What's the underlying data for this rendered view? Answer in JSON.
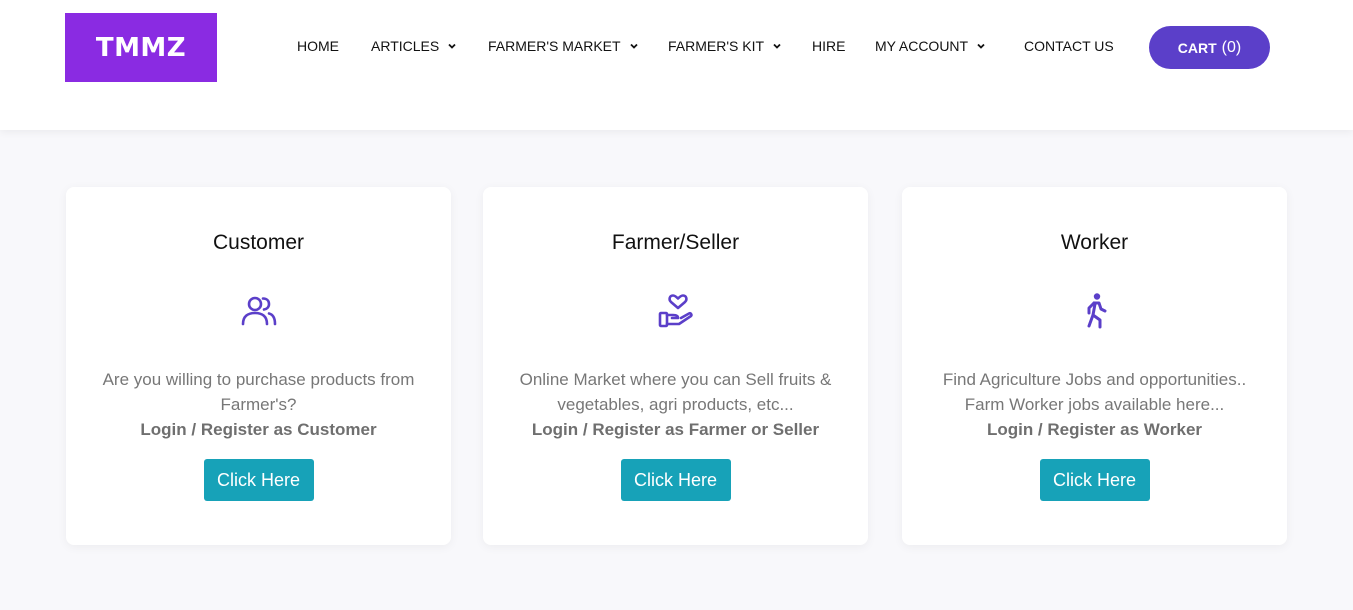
{
  "brand": {
    "logo_text": "TMMZ"
  },
  "nav": {
    "items": [
      {
        "label": "HOME"
      },
      {
        "label": "ARTICLES"
      },
      {
        "label": "FARMER'S MARKET"
      },
      {
        "label": "FARMER'S KIT"
      },
      {
        "label": "HIRE"
      },
      {
        "label": "MY ACCOUNT"
      },
      {
        "label": "CONTACT US"
      }
    ],
    "cart_label": "CART",
    "cart_count": "(0)"
  },
  "cards": [
    {
      "title": "Customer",
      "icon": "users-icon",
      "description": "Are you willing to purchase products from Farmer's?",
      "cta": "Login / Register as Customer",
      "button": "Click Here"
    },
    {
      "title": "Farmer/Seller",
      "icon": "hand-heart-icon",
      "description": "Online Market where you can Sell fruits & vegetables, agri products, etc...",
      "cta": "Login / Register as Farmer or Seller",
      "button": "Click Here"
    },
    {
      "title": "Worker",
      "icon": "running-person-icon",
      "description": "Find Agriculture Jobs and opportunities.. Farm Worker jobs available here...",
      "cta": "Login / Register as Worker",
      "button": "Click Here"
    }
  ],
  "colors": {
    "brand": "#8a2be2",
    "accent": "#5b3fc9",
    "button": "#17a2b8",
    "icon": "#5b3fc9"
  }
}
